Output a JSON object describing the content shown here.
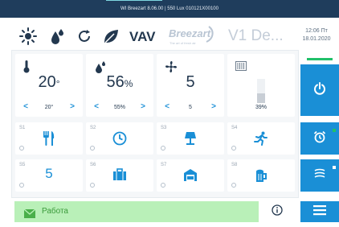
{
  "title_bar": {
    "text": "WI Breezart 8.06.00 | 550 Lux 010121X00100"
  },
  "header": {
    "icons": [
      "sun-icon",
      "water-drops-icon",
      "refresh-icon",
      "leaf-icon"
    ],
    "mode": "VAV",
    "brand": "Breezart",
    "brand_tagline": "The art of fresh air",
    "device_name": "V1 De...",
    "time": "12:06 Пт",
    "date": "18.01.2020"
  },
  "tiles": {
    "temperature": {
      "icon": "thermometer-icon",
      "value": "20",
      "unit": "°",
      "setpoint": "20°",
      "dec": "<",
      "inc": ">"
    },
    "humidity": {
      "icon": "humidity-icon",
      "value": "56",
      "unit": "%",
      "setpoint": "55%",
      "dec": "<",
      "inc": ">"
    },
    "fan": {
      "icon": "fan-icon",
      "value": "5",
      "setpoint": "5",
      "dec": "<",
      "inc": ">"
    },
    "filter": {
      "icon": "filter-icon",
      "value": "39%",
      "level": 0.39
    }
  },
  "scenes": [
    {
      "label": "S1",
      "icon": "cutlery-icon"
    },
    {
      "label": "S2",
      "icon": "clock-icon"
    },
    {
      "label": "S3",
      "icon": "lamp-icon"
    },
    {
      "label": "S4",
      "icon": "running-icon"
    },
    {
      "label": "S5",
      "text": "5"
    },
    {
      "label": "S6",
      "icon": "briefcase-icon"
    },
    {
      "label": "S7",
      "icon": "garage-icon"
    },
    {
      "label": "S8",
      "icon": "beer-icon"
    }
  ],
  "side": {
    "power": "power-icon",
    "alarm": "alarm-icon",
    "heater": "heater-icon",
    "menu": "menu-icon"
  },
  "status": {
    "icon": "envelope-icon",
    "text": "Работа"
  },
  "info": {
    "icon": "info-icon"
  },
  "colors": {
    "accent": "#1a8fd6",
    "green": "#21c06a",
    "status_bg": "#b9f0b8",
    "dark": "#1f3d5c"
  }
}
